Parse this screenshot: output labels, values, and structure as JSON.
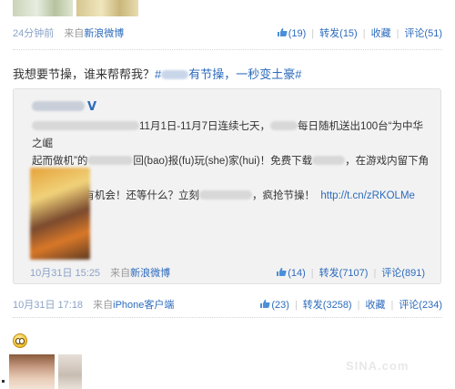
{
  "top_feed": {
    "time": "24分钟前",
    "from_prefix": "来自",
    "source": "新浪微博",
    "like_count": "(19)",
    "repost": "转发(15)",
    "favorite": "收藏",
    "comment": "评论(51)"
  },
  "post": {
    "text_prefix": "我想要节操，谁来帮帮我？",
    "hash_open": "#",
    "tag_tail": "有节操，一秒变土豪",
    "hash_close": "#"
  },
  "quote": {
    "badge": "V",
    "line1_a": "11月1日-11月7日连续七天，",
    "line1_b": "每日随机送出100台“为中华之崛",
    "line2_a": "起而做机”的",
    "line2_b": "回(bao)报(fu)玩(she)家(hui)！免费下载",
    "line2_c": "，在游戏内留下角色id及",
    "line3_a": "手机号码就有机会！还等什么？立刻",
    "line3_b": "，疯抢节操！",
    "link": "http://t.cn/zRKOLMe",
    "time": "10月31日 15:25",
    "from_prefix": "来自",
    "source": "新浪微博",
    "like_count": "(14)",
    "repost": "转发(7107)",
    "comment": "评论(891)"
  },
  "post_meta": {
    "time": "10月31日 17:18",
    "from_prefix": "来自",
    "source": "iPhone客户端",
    "like_count": "(23)",
    "repost": "转发(3258)",
    "favorite": "收藏",
    "comment": "评论(234)"
  },
  "watermark": "SINA.com"
}
